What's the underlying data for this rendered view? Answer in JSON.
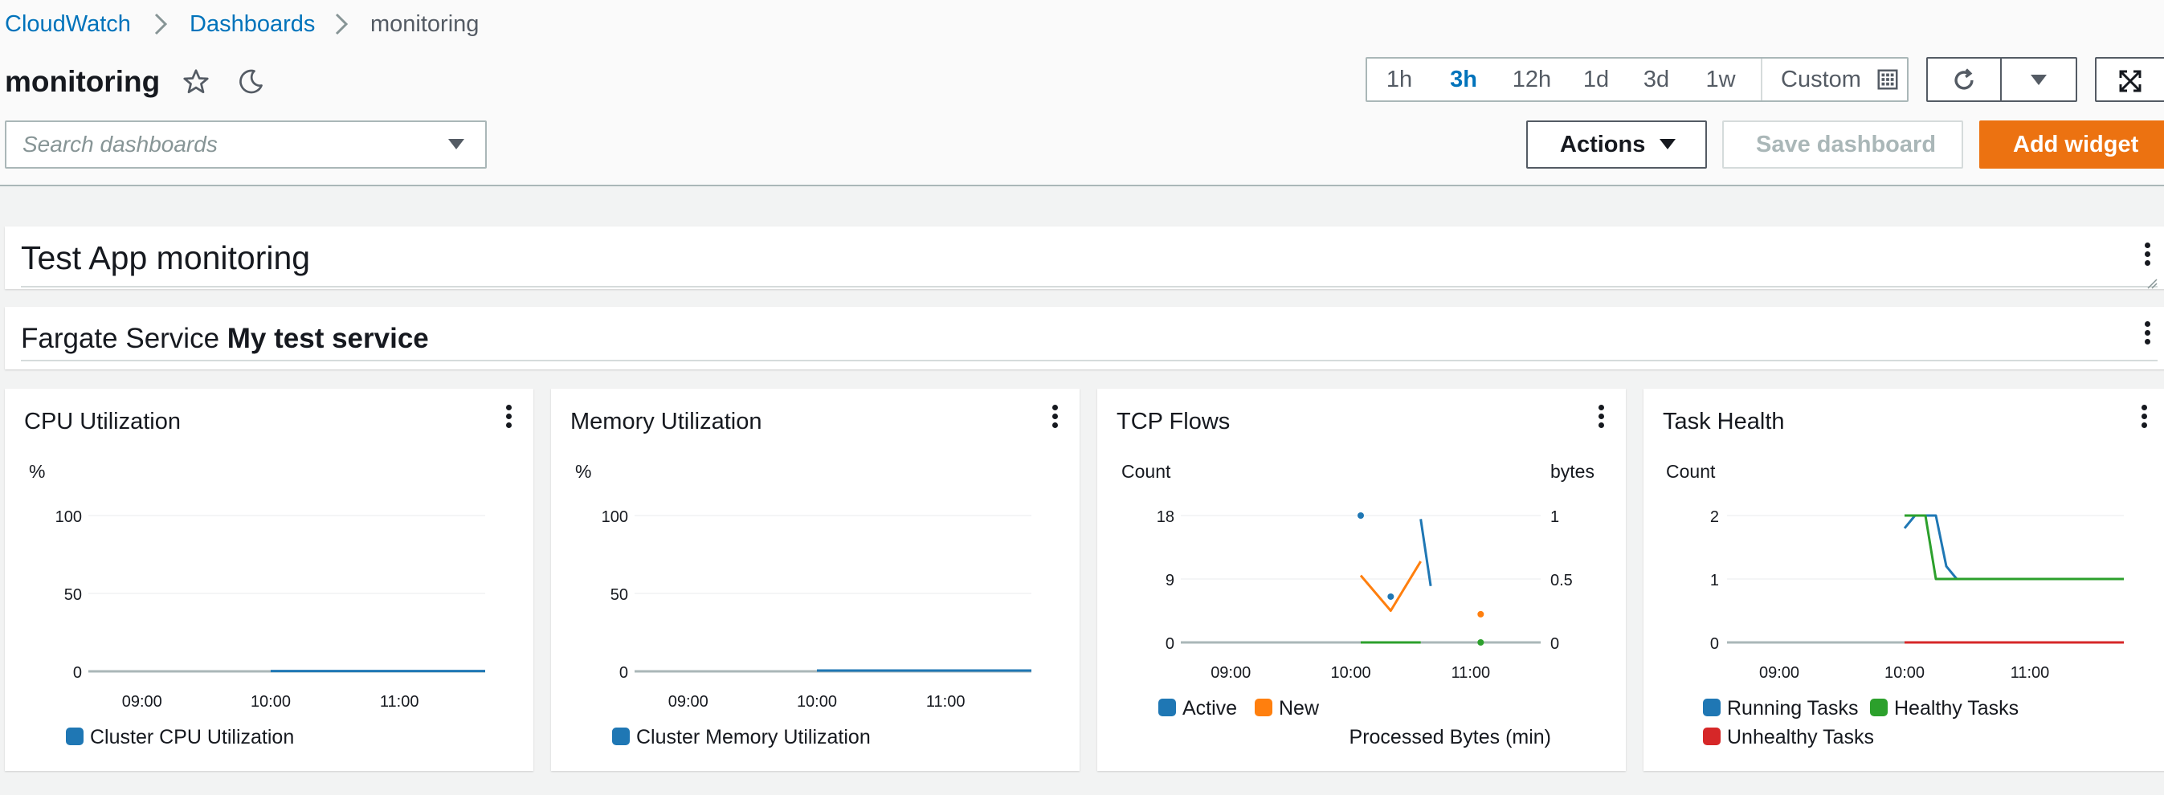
{
  "breadcrumb": {
    "root": "CloudWatch",
    "section": "Dashboards",
    "current": "monitoring"
  },
  "page_title": "monitoring",
  "time_ranges": [
    "1h",
    "3h",
    "12h",
    "1d",
    "3d",
    "1w"
  ],
  "time_range_selected": "3h",
  "custom_label": "Custom",
  "search": {
    "placeholder": "Search dashboards"
  },
  "buttons": {
    "actions": "Actions",
    "save": "Save dashboard",
    "add_widget": "Add widget"
  },
  "colors": {
    "blue": "#1f77b4",
    "orange": "#ff7f0e",
    "green": "#2ca02c",
    "red": "#d62728",
    "brand_orange": "#ec7211",
    "link": "#0073bb"
  },
  "text_widget_1": {
    "title": "Test App monitoring"
  },
  "text_widget_2": {
    "prefix": "Fargate Service ",
    "name": "My test service"
  },
  "widgets": [
    {
      "title": "CPU Utilization",
      "unit_left": "%",
      "y_ticks": [
        "100",
        "50",
        "0"
      ],
      "x_ticks": [
        "09:00",
        "10:00",
        "11:00"
      ],
      "legend": [
        "Cluster CPU Utilization"
      ]
    },
    {
      "title": "Memory Utilization",
      "unit_left": "%",
      "y_ticks": [
        "100",
        "50",
        "0"
      ],
      "x_ticks": [
        "09:00",
        "10:00",
        "11:00"
      ],
      "legend": [
        "Cluster Memory Utilization"
      ]
    },
    {
      "title": "TCP Flows",
      "unit_left": "Count",
      "unit_right": "bytes",
      "y_ticks": [
        "18",
        "9",
        "0"
      ],
      "y_ticks_right": [
        "1",
        "0.5",
        "0"
      ],
      "x_ticks": [
        "09:00",
        "10:00",
        "11:00"
      ],
      "legend": [
        "Active",
        "New"
      ],
      "legend_overflow": "Processed Bytes (min)"
    },
    {
      "title": "Task Health",
      "unit_left": "Count",
      "y_ticks": [
        "2",
        "1",
        "0"
      ],
      "x_ticks": [
        "09:00",
        "10:00",
        "11:00"
      ],
      "legend": [
        "Running Tasks",
        "Healthy Tasks",
        "Unhealthy Tasks"
      ]
    }
  ],
  "chart_data": [
    {
      "type": "line",
      "title": "CPU Utilization",
      "ylabel": "%",
      "ylim": [
        0,
        100
      ],
      "x_range": [
        "08:35",
        "11:40"
      ],
      "series": [
        {
          "name": "Cluster CPU Utilization",
          "x": [
            "10:00",
            "11:40"
          ],
          "values": [
            0.2,
            0.2
          ]
        }
      ]
    },
    {
      "type": "line",
      "title": "Memory Utilization",
      "ylabel": "%",
      "ylim": [
        0,
        100
      ],
      "x_range": [
        "08:35",
        "11:40"
      ],
      "series": [
        {
          "name": "Cluster Memory Utilization",
          "x": [
            "10:00",
            "11:40"
          ],
          "values": [
            0.5,
            0.5
          ]
        }
      ]
    },
    {
      "type": "line",
      "title": "TCP Flows",
      "ylabel": "Count",
      "ylabel_right": "bytes",
      "ylim": [
        0,
        18
      ],
      "ylim_right": [
        0,
        1
      ],
      "x_range": [
        "08:35",
        "11:35"
      ],
      "series": [
        {
          "name": "Active",
          "x": [
            "10:05",
            "10:20",
            "10:35",
            "10:40"
          ],
          "values": [
            18,
            6.5,
            17.5,
            8
          ],
          "segments": [
            [
              0
            ],
            [
              1
            ],
            [
              2,
              3
            ]
          ]
        },
        {
          "name": "New",
          "x": [
            "10:05",
            "10:20",
            "10:35",
            "11:05"
          ],
          "values": [
            9.5,
            4.5,
            11.5,
            4
          ],
          "segments": [
            [
              0,
              1,
              2
            ],
            [
              3
            ]
          ]
        },
        {
          "name": "Processed Bytes (min)",
          "axis": "right",
          "x": [
            "10:05",
            "10:35",
            "11:05"
          ],
          "values": [
            0,
            0,
            0
          ],
          "segments": [
            [
              0,
              1
            ],
            [
              2
            ]
          ]
        }
      ]
    },
    {
      "type": "line",
      "title": "Task Health",
      "ylabel": "Count",
      "ylim": [
        0,
        2
      ],
      "x_range": [
        "08:35",
        "11:45"
      ],
      "series": [
        {
          "name": "Running Tasks",
          "x": [
            "10:00",
            "10:05",
            "10:15",
            "10:20",
            "10:25"
          ],
          "values": [
            1.8,
            2,
            2,
            1.2,
            1
          ]
        },
        {
          "name": "Healthy Tasks",
          "x": [
            "10:00",
            "10:10",
            "10:15",
            "11:45"
          ],
          "values": [
            2,
            2,
            1,
            1
          ]
        },
        {
          "name": "Unhealthy Tasks",
          "x": [
            "10:00",
            "11:45"
          ],
          "values": [
            0,
            0
          ]
        }
      ]
    }
  ]
}
